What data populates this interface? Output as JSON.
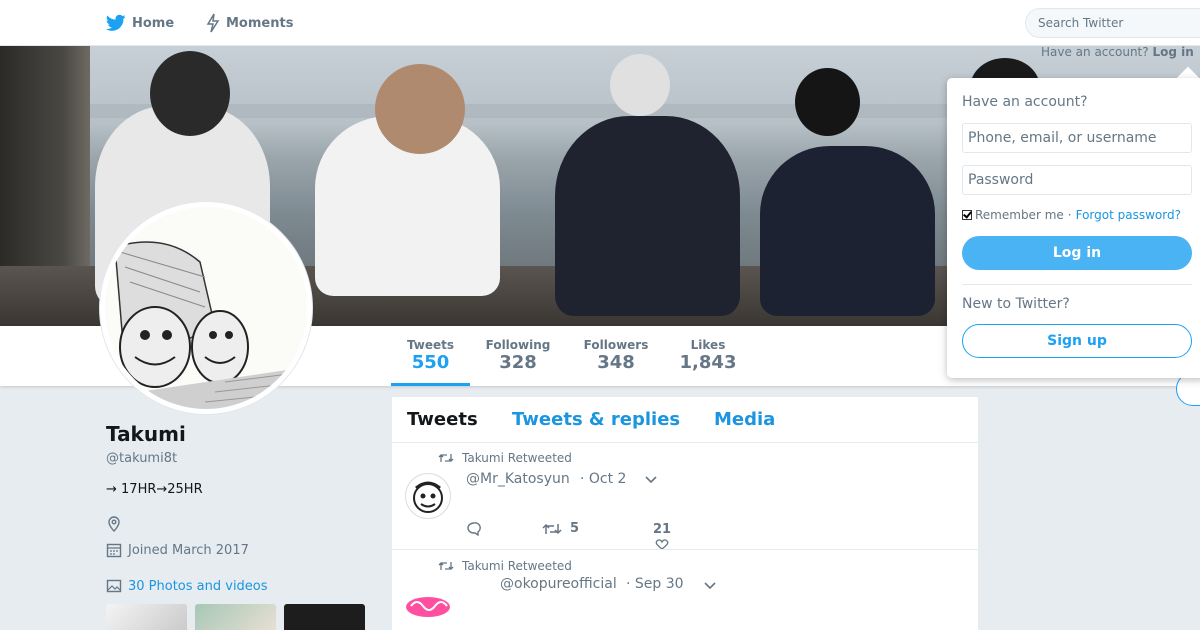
{
  "nav": {
    "home_label": "Home",
    "moments_label": "Moments",
    "search_placeholder": "Search Twitter",
    "have_account_prefix": "Have an account?",
    "login_link": "Log in"
  },
  "stats": [
    {
      "label": "Tweets",
      "value": "550"
    },
    {
      "label": "Following",
      "value": "328"
    },
    {
      "label": "Followers",
      "value": "348"
    },
    {
      "label": "Likes",
      "value": "1,843"
    }
  ],
  "profile": {
    "name": "Takumi",
    "handle": "@takumi8t",
    "bio": "→ 17HR→25HR",
    "joined": "Joined March 2017",
    "photos_link": "30 Photos and videos"
  },
  "timeline": {
    "tabs": [
      "Tweets",
      "Tweets & replies",
      "Media"
    ],
    "tweets": [
      {
        "retweet_label": "Takumi Retweeted",
        "user": "@Mr_Katosyun",
        "time": "· Oct 2",
        "retweets": "5",
        "likes": "21"
      },
      {
        "retweet_label": "Takumi Retweeted",
        "user": "@okopureofficial",
        "time": "· Sep 30"
      }
    ]
  },
  "login_popup": {
    "title": "Have an account?",
    "username_placeholder": "Phone, email, or username",
    "password_placeholder": "Password",
    "remember_label": "Remember me",
    "separator": "·",
    "forgot_label": "Forgot password?",
    "login_button": "Log in",
    "new_title": "New to Twitter?",
    "signup_button": "Sign up"
  },
  "colors": {
    "accent": "#1da1f2",
    "link": "#1b95e0",
    "background": "#e6ecf0"
  }
}
